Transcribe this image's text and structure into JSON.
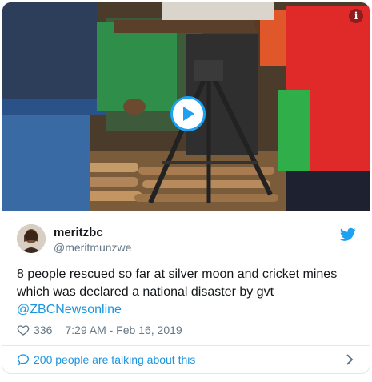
{
  "tweet": {
    "display_name": "meritzbc",
    "handle": "@meritmunzwe",
    "text_main": "8 people rescued so far at silver moon and cricket mines which was declared a national disaster by gvt ",
    "text_mention": "@ZBCNewsonline",
    "likes": "336",
    "timestamp": "7:29 AM - Feb 16, 2019"
  },
  "footer": {
    "talking_label": "200 people are talking about this"
  },
  "icons": {
    "play": "play-icon",
    "info": "info-icon",
    "twitter": "twitter-bird-icon",
    "heart": "heart-icon",
    "reply": "speech-bubble-icon",
    "chevron": "chevron-right-icon"
  },
  "colors": {
    "accent": "#1da1f2",
    "link": "#1b95e0",
    "muted": "#657786",
    "border": "#e1e8ed"
  }
}
